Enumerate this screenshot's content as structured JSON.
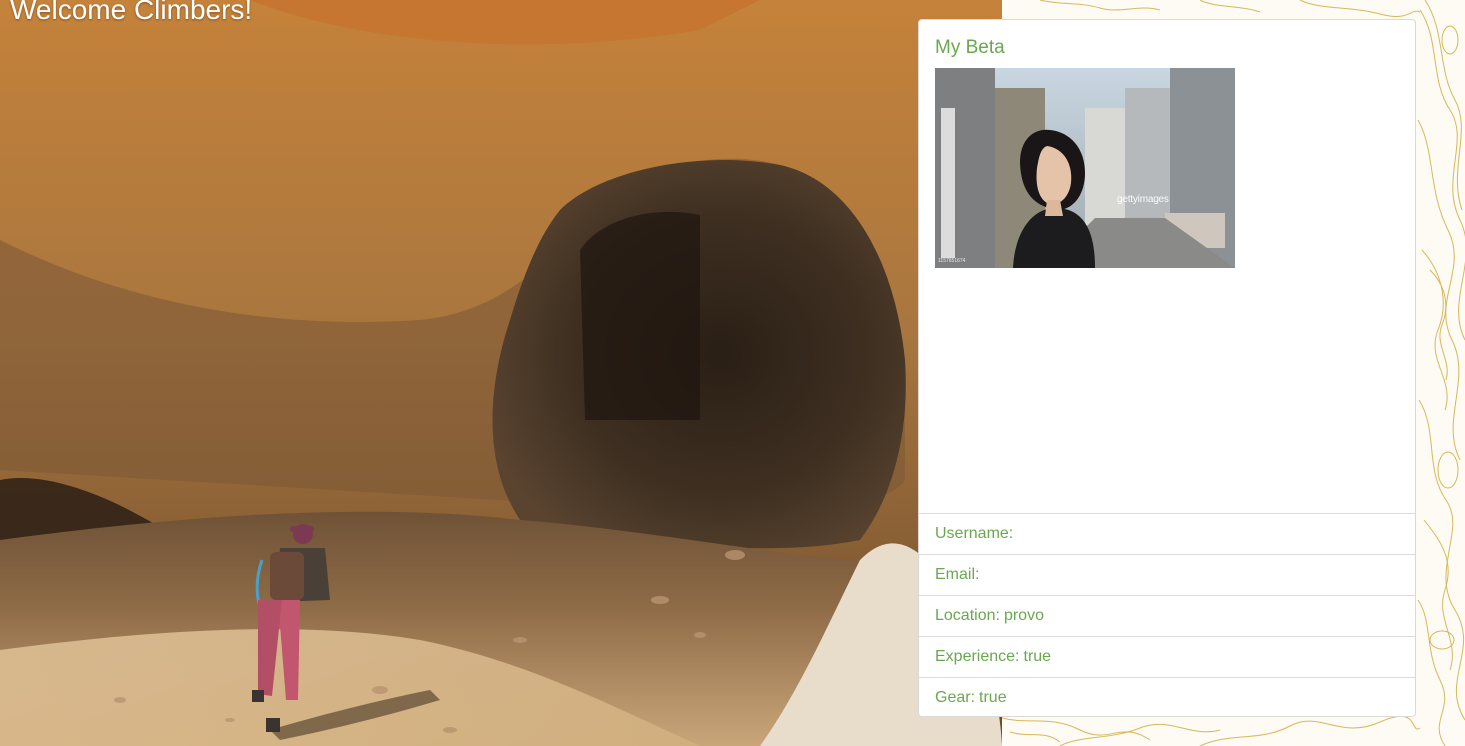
{
  "hero": {
    "heading": "Welcome Climbers!"
  },
  "profile": {
    "title": "My Beta",
    "photo": {
      "watermark": "gettyimages",
      "watermark_sub": "mariusmarius",
      "image_id": "1157651674"
    },
    "details": [
      {
        "label": "Username:",
        "value": ""
      },
      {
        "label": "Email:",
        "value": ""
      },
      {
        "label": "Location:",
        "value": "provo"
      },
      {
        "label": "Experience:",
        "value": "true"
      },
      {
        "label": "Gear:",
        "value": "true"
      }
    ]
  },
  "colors": {
    "accent": "#6aa84f",
    "card_border": "#d9d9d9",
    "topo_line": "#c9a227"
  }
}
